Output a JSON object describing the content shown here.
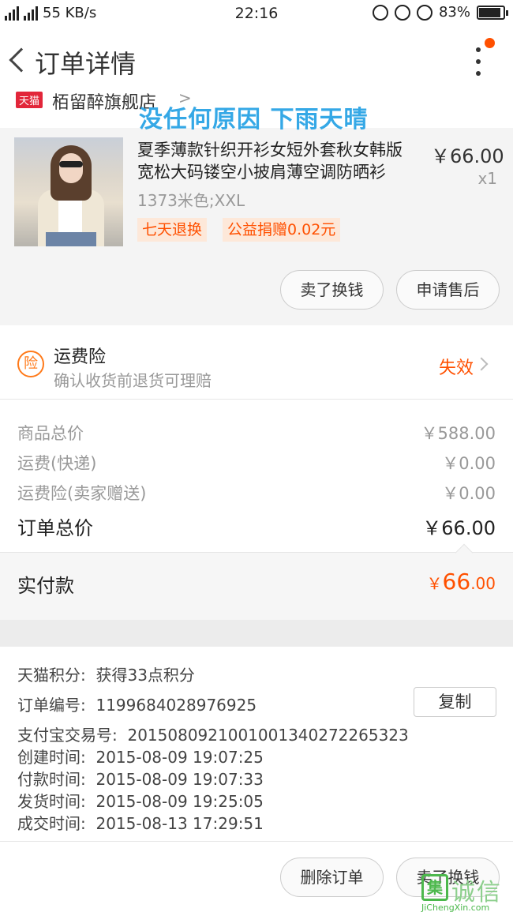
{
  "status_bar": {
    "network": "4G",
    "network2": "2G",
    "speed": "55 KB/s",
    "time": "22:16",
    "battery": "83%"
  },
  "header": {
    "title": "订单详情"
  },
  "store": {
    "badge": "天猫",
    "name": "栢留醉旗舰店",
    "chevron": ">"
  },
  "overlay_caption": "没任何原因 下雨天晴",
  "item": {
    "title": "夏季薄款针织开衫女短外套秋女韩版宽松大码镂空小披肩薄空调防晒衫",
    "sku": "1373米色;XXL",
    "price": "￥66.00",
    "quantity": "x1",
    "tags": [
      "七天退换",
      "公益捐赠0.02元"
    ],
    "buttons": {
      "sell": "卖了换钱",
      "after_sale": "申请售后"
    }
  },
  "insurance": {
    "icon_text": "险",
    "title": "运费险",
    "subtitle": "确认收货前退货可理赔",
    "status": "失效"
  },
  "costs": {
    "items": [
      {
        "label": "商品总价",
        "value": "￥588.00"
      },
      {
        "label": "运费(快递)",
        "value": "￥0.00"
      },
      {
        "label": "运费险(卖家赠送)",
        "value": "￥0.00"
      }
    ],
    "total_label": "订单总价",
    "total_value": "￥66.00"
  },
  "paid": {
    "label": "实付款",
    "currency": "￥",
    "integer": "66",
    "decimal": ".00"
  },
  "info": {
    "points_label": "天猫积分:",
    "points_value": "获得33点积分",
    "order_no_label": "订单编号:",
    "order_no_value": "1199684028976925",
    "copy_label": "复制",
    "alipay_label": "支付宝交易号:",
    "alipay_value": "2015080921001001340272265323",
    "created_label": "创建时间:",
    "created_value": "2015-08-09 19:07:25",
    "paid_label": "付款时间:",
    "paid_value": "2015-08-09 19:07:33",
    "shipped_label": "发货时间:",
    "shipped_value": "2015-08-09 19:25:05",
    "closed_label": "成交时间:",
    "closed_value": "2015-08-13 17:29:51"
  },
  "footer": {
    "delete_label": "删除订单",
    "sell_label": "卖了换钱"
  },
  "watermark": {
    "mark": "集",
    "name": "诚信",
    "url": "JiChengXin.com"
  },
  "colors": {
    "accent": "#ff5000",
    "caption": "#35a8e6",
    "tmall_red": "#e2263a"
  }
}
